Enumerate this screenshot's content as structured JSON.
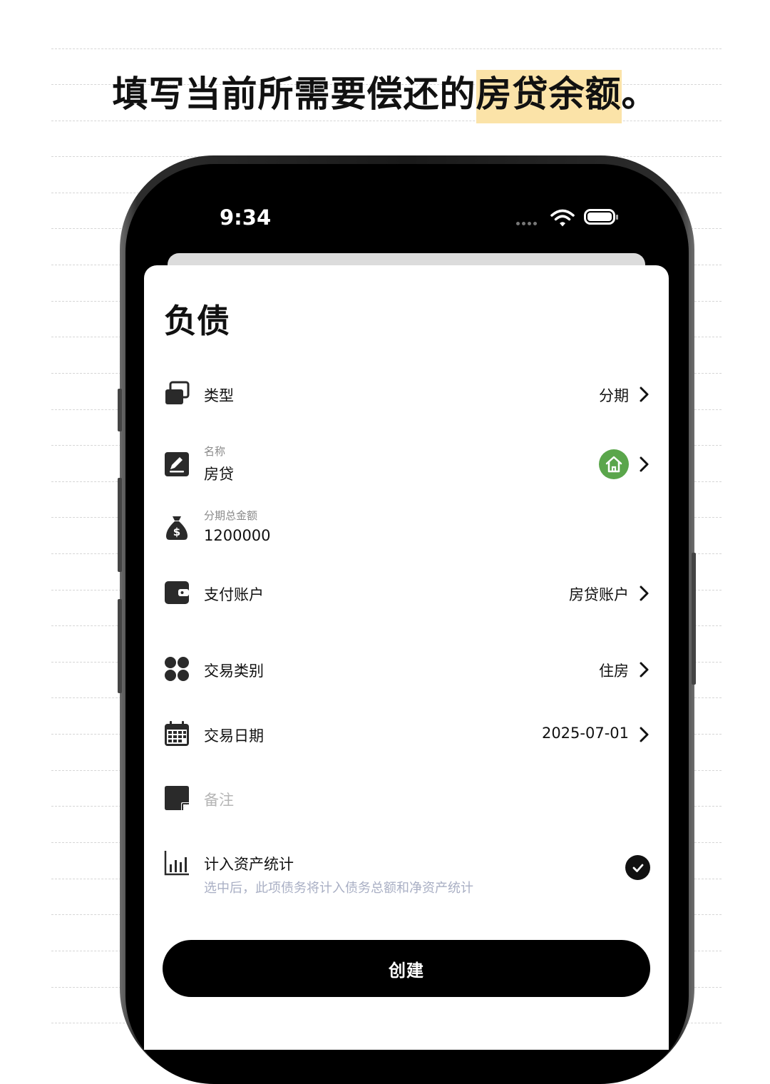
{
  "headline": {
    "text_before": "填写当前所需要偿还的",
    "highlight": "房贷余额",
    "text_after": "。"
  },
  "status_bar": {
    "time": "9:34"
  },
  "sheet": {
    "title": "负债",
    "rows": {
      "type": {
        "label": "类型",
        "value": "分期",
        "icon": "cards-icon"
      },
      "name": {
        "sublabel": "名称",
        "label": "房贷",
        "icon": "edit-icon",
        "badge_icon": "house-icon"
      },
      "total": {
        "sublabel": "分期总金额",
        "label": "1200000",
        "icon": "money-bag-icon"
      },
      "account": {
        "label": "支付账户",
        "value": "房贷账户",
        "icon": "wallet-icon"
      },
      "category": {
        "label": "交易类别",
        "value": "住房",
        "icon": "grid-icon"
      },
      "date": {
        "label": "交易日期",
        "value": "2025-07-01",
        "icon": "calendar-icon"
      },
      "note": {
        "placeholder": "备注",
        "icon": "note-icon"
      },
      "asset_stats": {
        "label": "计入资产统计",
        "hint": "选中后，此项债务将计入债务总额和净资产统计",
        "checked": true,
        "icon": "bar-chart-icon"
      }
    },
    "create_button": "创建"
  },
  "colors": {
    "accent_green": "#5aa64b",
    "highlight": "#fbe3a8",
    "button": "#000000",
    "hint": "#a9afc4"
  }
}
